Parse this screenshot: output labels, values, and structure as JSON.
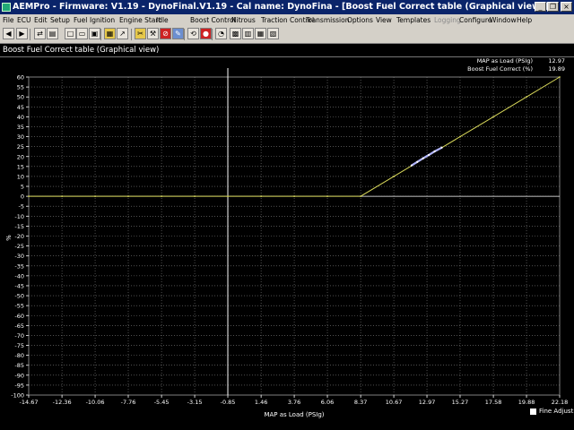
{
  "window": {
    "title": "AEMPro - Firmware: V1.19 - DynoFinal.V1.19 - Cal name: DynoFina - [Boost Fuel Correct table (Graphical view)]",
    "minimize_glyph": "_",
    "restore_glyph": "❐",
    "close_glyph": "×"
  },
  "menu": [
    {
      "label": "File",
      "enabled": true
    },
    {
      "label": "ECU",
      "enabled": true
    },
    {
      "label": "Edit",
      "enabled": true
    },
    {
      "label": "Setup",
      "enabled": true
    },
    {
      "label": "Fuel",
      "enabled": true
    },
    {
      "label": "Ignition",
      "enabled": true
    },
    {
      "label": "Engine Start",
      "enabled": true
    },
    {
      "label": "Idle",
      "enabled": true
    },
    {
      "label": "Boost Control",
      "enabled": true
    },
    {
      "label": "Nitrous",
      "enabled": true
    },
    {
      "label": "Traction Control",
      "enabled": true
    },
    {
      "label": "Transmission",
      "enabled": true
    },
    {
      "label": "Options",
      "enabled": true
    },
    {
      "label": "View",
      "enabled": true
    },
    {
      "label": "Templates",
      "enabled": true
    },
    {
      "label": "Logging",
      "enabled": false
    },
    {
      "label": "Configure",
      "enabled": true
    },
    {
      "label": "Window",
      "enabled": true
    },
    {
      "label": "Help",
      "enabled": true
    }
  ],
  "toolbar": {
    "buttons": [
      {
        "icon": "back-arrow-icon",
        "glyph": "◀"
      },
      {
        "icon": "forward-arrow-icon",
        "glyph": "▶"
      },
      {
        "icon": "connect-icon",
        "glyph": "⇄"
      },
      {
        "icon": "print-icon",
        "glyph": "▤"
      },
      {
        "icon": "stop-icon",
        "glyph": "✕"
      },
      {
        "icon": "new-file-icon",
        "glyph": "□"
      },
      {
        "icon": "open-file-icon",
        "glyph": "▭"
      },
      {
        "icon": "save-icon",
        "glyph": "▣"
      },
      {
        "icon": "table-icon",
        "glyph": "▦"
      },
      {
        "icon": "graph-icon",
        "glyph": "↗"
      },
      {
        "icon": "tools-icon",
        "glyph": "✂"
      },
      {
        "icon": "wrench-icon",
        "glyph": "⚒"
      },
      {
        "icon": "no-entry-icon",
        "glyph": "⊘"
      },
      {
        "icon": "pen-icon",
        "glyph": "✎"
      },
      {
        "icon": "trace-icon",
        "glyph": "⟲"
      },
      {
        "icon": "record-icon",
        "glyph": "●"
      },
      {
        "icon": "gauge-icon",
        "glyph": "◔"
      },
      {
        "icon": "chip-icon",
        "glyph": "▩"
      },
      {
        "icon": "bars-icon",
        "glyph": "▥"
      },
      {
        "icon": "grid-icon",
        "glyph": "▦"
      },
      {
        "icon": "chart-icon",
        "glyph": "▧"
      }
    ]
  },
  "view_title": "Boost Fuel Correct table (Graphical view)",
  "readout": {
    "row1_label": "MAP as Load (PSIg)",
    "row1_value": "12.97",
    "row2_label": "Boost Fuel Correct (%)",
    "row2_value": "19.89"
  },
  "fine_adjust_label": "Fine Adjust",
  "colors": {
    "background": "#000000",
    "grid": "#808080",
    "curve": "#d8d85a",
    "trace": "#b0b4ff",
    "cursor": "#ffffff",
    "titlebar": "#0a246a",
    "chrome": "#d4d0c8"
  },
  "chart_data": {
    "type": "line",
    "xlabel": "MAP as Load (PSIg)",
    "ylabel": "%",
    "xlim": [
      -14.67,
      22.18
    ],
    "ylim": [
      -100,
      60
    ],
    "x_ticks": [
      "-14.67",
      "-12.36",
      "-10.06",
      "-7.76",
      "-5.45",
      "-3.15",
      "-0.85",
      "1.46",
      "3.76",
      "6.06",
      "8.37",
      "10.67",
      "12.97",
      "15.27",
      "17.58",
      "19.88",
      "22.18"
    ],
    "y_ticks": [
      60,
      55,
      50,
      45,
      40,
      35,
      30,
      25,
      20,
      15,
      10,
      5,
      0,
      -5,
      -10,
      -15,
      -20,
      -25,
      -30,
      -35,
      -40,
      -45,
      -50,
      -55,
      -60,
      -65,
      -70,
      -75,
      -80,
      -85,
      -90,
      -95,
      -100
    ],
    "grid": true,
    "cursor_x": -0.85,
    "series": [
      {
        "x": [
          -14.67,
          -12.36,
          -10.06,
          -7.76,
          -5.45,
          -3.15,
          -0.85,
          1.46,
          3.76,
          6.06,
          8.37,
          10.67,
          12.97,
          15.27,
          17.58,
          19.88,
          22.18
        ],
        "values": [
          0,
          0,
          0,
          0,
          0,
          0,
          0,
          0,
          0,
          0,
          0,
          10,
          20,
          30,
          40,
          50,
          60
        ]
      }
    ],
    "trace": {
      "x": [
        11.9,
        12.3,
        12.7,
        13.1,
        13.5,
        14.0
      ],
      "values": [
        15.5,
        17.3,
        19.1,
        20.8,
        22.6,
        24.5
      ]
    }
  }
}
